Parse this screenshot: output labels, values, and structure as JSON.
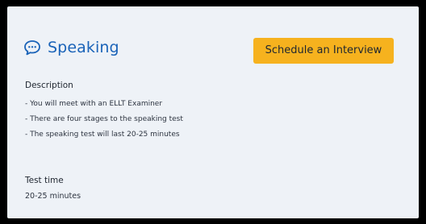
{
  "card": {
    "title": "Speaking",
    "icon": "speech-bubble-icon",
    "accent_color": "#1a63b8",
    "button_color": "#f6b21e",
    "cta_label": "Schedule an Interview",
    "description_label": "Description",
    "description_items": [
      "- You will meet with an ELLT Examiner",
      "- There are four stages to the speaking test",
      "- The speaking test will last 20-25 minutes"
    ],
    "test_time_label": "Test time",
    "test_time_value": "20-25 minutes"
  }
}
